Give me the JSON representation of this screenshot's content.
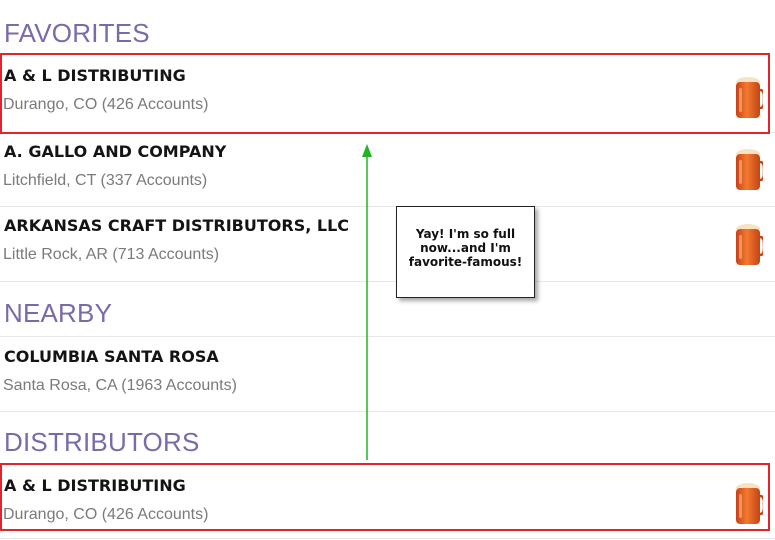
{
  "sections": {
    "favorites": {
      "title": "FAVORITES"
    },
    "nearby": {
      "title": "NEARBY"
    },
    "distributors": {
      "title": "DISTRIBUTORS"
    }
  },
  "favorites": [
    {
      "name": "A & L DISTRIBUTING",
      "location": "Durango, CO (426 Accounts)",
      "favorite": true
    },
    {
      "name": "A. GALLO AND COMPANY",
      "location": "Litchfield, CT (337 Accounts)",
      "favorite": true
    },
    {
      "name": "ARKANSAS CRAFT DISTRIBUTORS, LLC",
      "location": "Little Rock, AR (713 Accounts)",
      "favorite": true
    }
  ],
  "nearby": [
    {
      "name": "COLUMBIA SANTA ROSA",
      "location": "Santa Rosa, CA (1963 Accounts)",
      "favorite": false
    }
  ],
  "distributors": [
    {
      "name": "A & L DISTRIBUTING",
      "location": "Durango, CO (426 Accounts)",
      "favorite": true
    }
  ],
  "callout": {
    "text": "Yay! I'm so full now...and I'm favorite-famous!"
  },
  "colors": {
    "section_header": "#7b6aa9",
    "highlight": "#e0252c",
    "arrow": "#22b522",
    "beer": "#e8641e"
  },
  "icons": {
    "favorite_marker": "beer-mug-icon"
  }
}
